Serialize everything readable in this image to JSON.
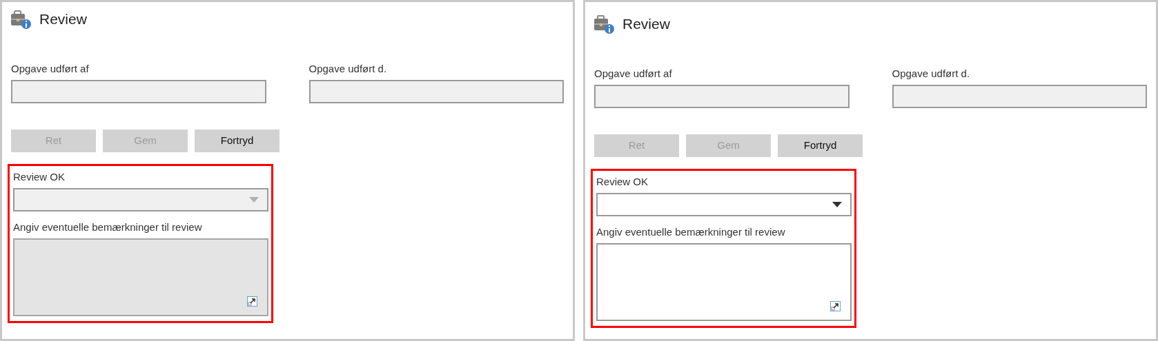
{
  "panels": [
    {
      "title": "Review",
      "fields": [
        {
          "label": "Opgave udført af",
          "disabled": true
        },
        {
          "label": "Opgave udført d.",
          "disabled": true
        }
      ],
      "buttons": [
        {
          "label": "Ret",
          "disabled": true
        },
        {
          "label": "Gem",
          "disabled": true
        },
        {
          "label": "Fortryd",
          "disabled": false
        }
      ],
      "highlighted": true,
      "review_ok": {
        "label": "Review OK",
        "disabled": true
      },
      "remarks": {
        "label": "Angiv eventuelle bemærkninger til review",
        "disabled": true
      }
    },
    {
      "title": "Review",
      "fields": [
        {
          "label": "Opgave udført af",
          "disabled": true
        },
        {
          "label": "Opgave udført d.",
          "disabled": true
        }
      ],
      "buttons": [
        {
          "label": "Ret",
          "disabled": true
        },
        {
          "label": "Gem",
          "disabled": true
        },
        {
          "label": "Fortryd",
          "disabled": false
        }
      ],
      "highlighted": true,
      "review_ok": {
        "label": "Review OK",
        "disabled": false
      },
      "remarks": {
        "label": "Angiv eventuelle bemærkninger til review",
        "disabled": false
      }
    }
  ]
}
